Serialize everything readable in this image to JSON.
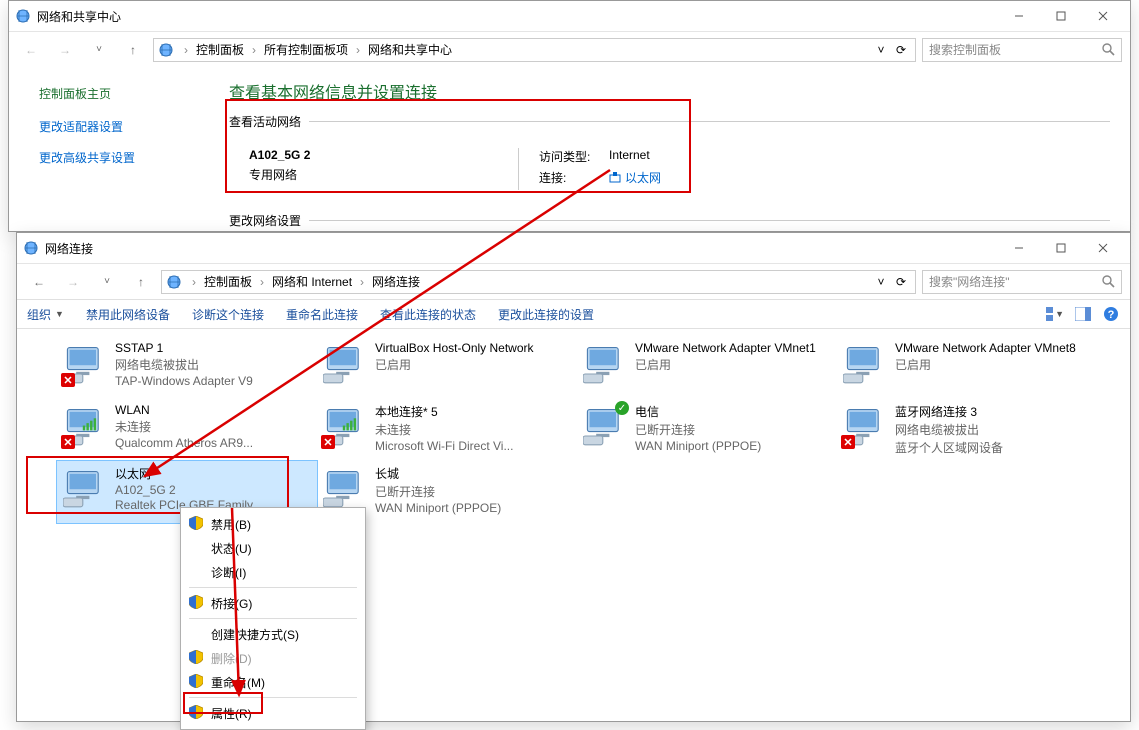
{
  "window1": {
    "title": "网络和共享中心",
    "breadcrumb": [
      "控制面板",
      "所有控制面板项",
      "网络和共享中心"
    ],
    "search_placeholder": "搜索控制面板",
    "sidebar": {
      "title": "控制面板主页",
      "items": [
        "更改适配器设置",
        "更改高级共享设置"
      ]
    },
    "heading": "查看基本网络信息并设置连接",
    "section1_label": "查看活动网络",
    "active_network": {
      "name": "A102_5G 2",
      "type": "专用网络",
      "access_label": "访问类型:",
      "access_value": "Internet",
      "conn_label": "连接:",
      "conn_value": "以太网"
    },
    "section2_label": "更改网络设置"
  },
  "window2": {
    "title": "网络连接",
    "breadcrumb": [
      "控制面板",
      "网络和 Internet",
      "网络连接"
    ],
    "search_placeholder": "搜索\"网络连接\"",
    "toolbar": {
      "organize": "组织",
      "items": [
        "禁用此网络设备",
        "诊断这个连接",
        "重命名此连接",
        "查看此连接的状态",
        "更改此连接的设置"
      ]
    },
    "connections": [
      {
        "name": "SSTAP 1",
        "status": "网络电缆被拔出",
        "device": "TAP-Windows Adapter V9",
        "x": true
      },
      {
        "name": "VirtualBox Host-Only Network",
        "status": "已启用",
        "device": ""
      },
      {
        "name": "VMware Network Adapter VMnet1",
        "status": "已启用",
        "device": ""
      },
      {
        "name": "VMware Network Adapter VMnet8",
        "status": "已启用",
        "device": ""
      },
      {
        "name": "WLAN",
        "status": "未连接",
        "device": "Qualcomm Atheros AR9...",
        "x": true
      },
      {
        "name": "本地连接* 5",
        "status": "未连接",
        "device": "Microsoft Wi-Fi Direct Vi...",
        "x": true
      },
      {
        "name": "电信",
        "status": "已断开连接",
        "device": "WAN Miniport (PPPOE)",
        "check": true
      },
      {
        "name": "蓝牙网络连接 3",
        "status": "网络电缆被拔出",
        "device": "蓝牙个人区域网设备",
        "x": true
      },
      {
        "name": "以太网",
        "status": "A102_5G 2",
        "device": "Realtek PCIe GBE Family...",
        "selected": true
      },
      {
        "name": "长城",
        "status": "已断开连接",
        "device": "WAN Miniport (PPPOE)"
      }
    ],
    "context_menu": [
      {
        "label": "禁用(B)",
        "shield": true
      },
      {
        "label": "状态(U)"
      },
      {
        "label": "诊断(I)"
      },
      {
        "sep": true
      },
      {
        "label": "桥接(G)",
        "shield": true
      },
      {
        "sep": true
      },
      {
        "label": "创建快捷方式(S)"
      },
      {
        "label": "删除(D)",
        "shield": true,
        "disabled": true
      },
      {
        "label": "重命名(M)",
        "shield": true
      },
      {
        "sep": true
      },
      {
        "label": "属性(R)",
        "shield": true,
        "highlight": true
      }
    ]
  }
}
